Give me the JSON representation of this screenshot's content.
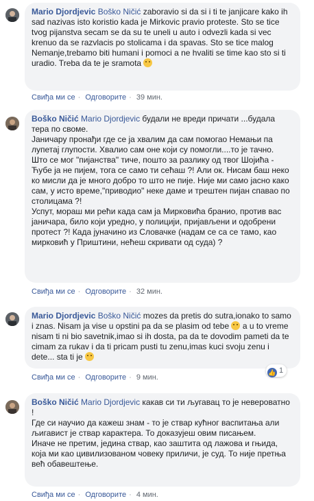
{
  "comments": [
    {
      "author": "Mario Djordjevic",
      "mention": "Boško Ničić",
      "text": " zaboravio si da si i ti te janjicare kako ih sad nazivas isto koristio kada je Mirkovic pravio proteste. Sto se tice tvog pijanstva secam se da su te uneli u auto i odvezli kada si vec krenuo da se razvlacis po stolicama i da spavas. Sto se tice malog Nemanje,trebamo biti humani i pomoci a ne hvaliti se time kao sto si ti uradio. Treba da te je sramota ",
      "like": "Свиђа ми се",
      "reply": "Одговорите",
      "time": "39 мин."
    },
    {
      "author": "Boško Ničić",
      "mention": "Mario Djordjevic",
      "text": " будали не вреди причати ...будала тера по своме.\nЈаничару пронађи где се ја хвалим да сам помогао Немањи па лупетај глупости. Хвалио сам оне који су помогли....то је тачно.\nШто се мог \"пијанства\" тиче, пошто за разлику од твог Шојића - Ћубе ја не пијем, тога се само ти сећаш ?! Али ок. Нисам баш неко ко мисли да је много добро то што не пије. Није ми само јасно како сам, у исто време,\"приводио\" неке даме и трештен пијан спавао по столицама ?!\nУспут, мораш ми рећи када сам ја Мирковића бранио, против вас јаничара, било који уредно, у полицији, пријављени и одобрени протест ?! Када јуначино из Словачке (надам се са се тамо, као мирковић у Приштини, нећеш скривати од суда) ?",
      "like": "Свиђа ми се",
      "reply": "Одговорите",
      "time": "32 мин."
    },
    {
      "author": "Mario Djordjevic",
      "mention": "Boško Ničić",
      "text_a": " mozes da pretis do sutra,ionako to samo i znas. Nisam ja vise u opstini pa da se plasim od tebe ",
      "text_b": " a u to vreme nisam ti ni bio savetnik,imao si ih dosta, pa da te dovodim pameti da te cimam za rukav i da ti pricam pusti tu zenu,imas kuci svoju zenu i dete... sta ti je ",
      "like": "Свиђа ми се",
      "reply": "Одговорите",
      "time": "9 мин.",
      "reactions": "1"
    },
    {
      "author": "Boško Ničić",
      "mention": "Mario Djordjevic",
      "text": " какав си ти љугавац то је невероватно !\nГде си научио да кажеш знам - то је ствар кућног васпитања али љигавист је ствар карактера. То доказујеш овим писањем.\nИначе не претим, једина ствар, као заштита од лажова и гњида, која ми као цивилизованом човеку приличи, је суд. То није претња већ обавештење.",
      "like": "Свиђа ми се",
      "reply": "Одговорите",
      "time": "4 мин."
    }
  ],
  "colors": {
    "name": "#385898",
    "bubble": "#f2f3f5",
    "meta": "#606770",
    "like_badge": "#4267b2"
  }
}
